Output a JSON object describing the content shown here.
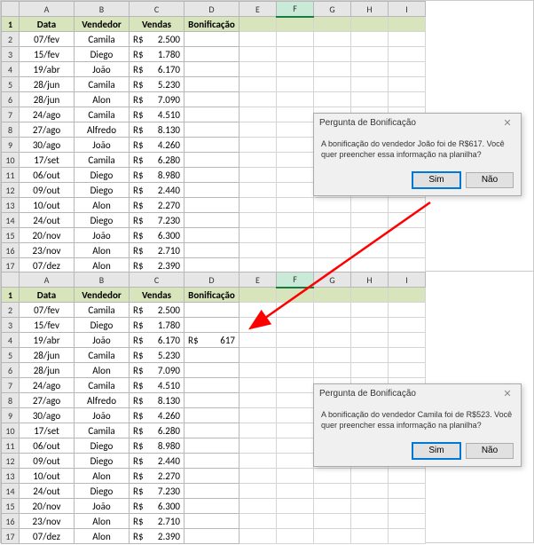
{
  "columns": [
    "A",
    "B",
    "C",
    "D",
    "E",
    "F",
    "G",
    "H",
    "I"
  ],
  "rowNums": [
    "1",
    "2",
    "3",
    "4",
    "5",
    "6",
    "7",
    "8",
    "9",
    "10",
    "11",
    "12",
    "13",
    "14",
    "15",
    "16",
    "17"
  ],
  "headers": {
    "a": "Data",
    "b": "Vendedor",
    "c": "Vendas",
    "d": "Bonificação"
  },
  "rows": [
    {
      "data": "07/fev",
      "vend": "Camila",
      "cur": "R$",
      "val": "2.500",
      "bonCur": "",
      "bonVal": ""
    },
    {
      "data": "15/fev",
      "vend": "Diego",
      "cur": "R$",
      "val": "1.780",
      "bonCur": "",
      "bonVal": ""
    },
    {
      "data": "19/abr",
      "vend": "João",
      "cur": "R$",
      "val": "6.170",
      "bonCur": "",
      "bonVal": ""
    },
    {
      "data": "28/jun",
      "vend": "Camila",
      "cur": "R$",
      "val": "5.230",
      "bonCur": "",
      "bonVal": ""
    },
    {
      "data": "28/jun",
      "vend": "Alon",
      "cur": "R$",
      "val": "7.090",
      "bonCur": "",
      "bonVal": ""
    },
    {
      "data": "24/ago",
      "vend": "Camila",
      "cur": "R$",
      "val": "4.510",
      "bonCur": "",
      "bonVal": ""
    },
    {
      "data": "27/ago",
      "vend": "Alfredo",
      "cur": "R$",
      "val": "8.130",
      "bonCur": "",
      "bonVal": ""
    },
    {
      "data": "30/ago",
      "vend": "João",
      "cur": "R$",
      "val": "4.260",
      "bonCur": "",
      "bonVal": ""
    },
    {
      "data": "17/set",
      "vend": "Camila",
      "cur": "R$",
      "val": "6.280",
      "bonCur": "",
      "bonVal": ""
    },
    {
      "data": "06/out",
      "vend": "Diego",
      "cur": "R$",
      "val": "8.980",
      "bonCur": "",
      "bonVal": ""
    },
    {
      "data": "09/out",
      "vend": "Diego",
      "cur": "R$",
      "val": "2.440",
      "bonCur": "",
      "bonVal": ""
    },
    {
      "data": "10/out",
      "vend": "Alon",
      "cur": "R$",
      "val": "2.270",
      "bonCur": "",
      "bonVal": ""
    },
    {
      "data": "24/out",
      "vend": "Diego",
      "cur": "R$",
      "val": "7.230",
      "bonCur": "",
      "bonVal": ""
    },
    {
      "data": "20/nov",
      "vend": "João",
      "cur": "R$",
      "val": "6.300",
      "bonCur": "",
      "bonVal": ""
    },
    {
      "data": "23/nov",
      "vend": "Alon",
      "cur": "R$",
      "val": "2.710",
      "bonCur": "",
      "bonVal": ""
    },
    {
      "data": "07/dez",
      "vend": "Alon",
      "cur": "R$",
      "val": "2.390",
      "bonCur": "",
      "bonVal": ""
    }
  ],
  "rows2": [
    {
      "data": "07/fev",
      "vend": "Camila",
      "cur": "R$",
      "val": "2.500",
      "bonCur": "",
      "bonVal": ""
    },
    {
      "data": "15/fev",
      "vend": "Diego",
      "cur": "R$",
      "val": "1.780",
      "bonCur": "",
      "bonVal": ""
    },
    {
      "data": "19/abr",
      "vend": "João",
      "cur": "R$",
      "val": "6.170",
      "bonCur": "R$",
      "bonVal": "617"
    },
    {
      "data": "28/jun",
      "vend": "Camila",
      "cur": "R$",
      "val": "5.230",
      "bonCur": "",
      "bonVal": ""
    },
    {
      "data": "28/jun",
      "vend": "Alon",
      "cur": "R$",
      "val": "7.090",
      "bonCur": "",
      "bonVal": ""
    },
    {
      "data": "24/ago",
      "vend": "Camila",
      "cur": "R$",
      "val": "4.510",
      "bonCur": "",
      "bonVal": ""
    },
    {
      "data": "27/ago",
      "vend": "Alfredo",
      "cur": "R$",
      "val": "8.130",
      "bonCur": "",
      "bonVal": ""
    },
    {
      "data": "30/ago",
      "vend": "João",
      "cur": "R$",
      "val": "4.260",
      "bonCur": "",
      "bonVal": ""
    },
    {
      "data": "17/set",
      "vend": "Camila",
      "cur": "R$",
      "val": "6.280",
      "bonCur": "",
      "bonVal": ""
    },
    {
      "data": "06/out",
      "vend": "Diego",
      "cur": "R$",
      "val": "8.980",
      "bonCur": "",
      "bonVal": ""
    },
    {
      "data": "09/out",
      "vend": "Diego",
      "cur": "R$",
      "val": "2.440",
      "bonCur": "",
      "bonVal": ""
    },
    {
      "data": "10/out",
      "vend": "Alon",
      "cur": "R$",
      "val": "2.270",
      "bonCur": "",
      "bonVal": ""
    },
    {
      "data": "24/out",
      "vend": "Diego",
      "cur": "R$",
      "val": "7.230",
      "bonCur": "",
      "bonVal": ""
    },
    {
      "data": "20/nov",
      "vend": "João",
      "cur": "R$",
      "val": "6.300",
      "bonCur": "",
      "bonVal": ""
    },
    {
      "data": "23/nov",
      "vend": "Alon",
      "cur": "R$",
      "val": "2.710",
      "bonCur": "",
      "bonVal": ""
    },
    {
      "data": "07/dez",
      "vend": "Alon",
      "cur": "R$",
      "val": "2.390",
      "bonCur": "",
      "bonVal": ""
    }
  ],
  "dialog1": {
    "title": "Pergunta de Bonificação",
    "body": "A bonificação do vendedor João foi de R$617. Você quer preencher essa informação na planilha?",
    "yes": "Sim",
    "no": "Não"
  },
  "dialog2": {
    "title": "Pergunta de Bonificação",
    "body": "A bonificação do vendedor Camila foi de R$523. Você quer preencher essa informação na planilha?",
    "yes": "Sim",
    "no": "Não"
  }
}
